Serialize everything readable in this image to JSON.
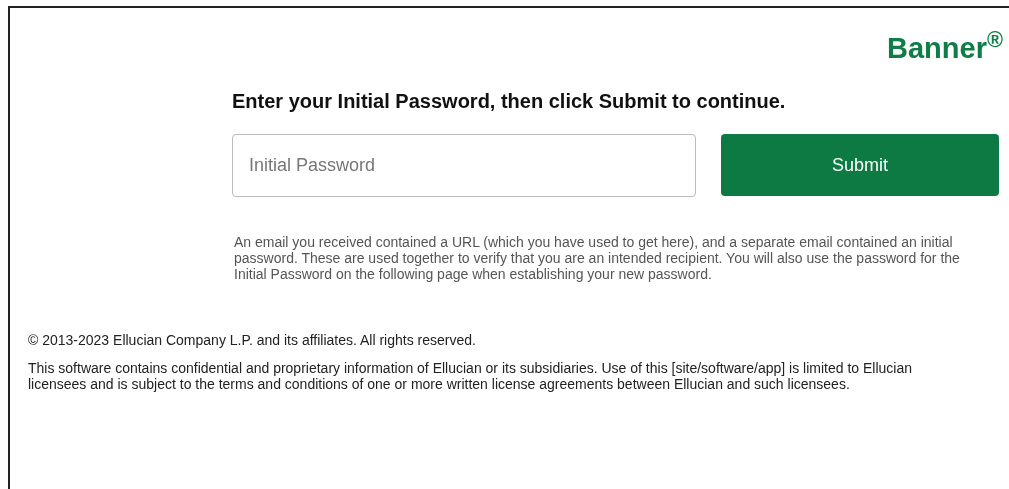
{
  "logo": "Banner$^{®}$",
  "heading": "Enter your Initial Password, then click Submit to continue.",
  "password_field": {
    "placeholder": "Initial Password"
  },
  "submit_button": "Submit",
  "help_text": "An email you received contained a URL (which you have used to get here), and a separate email contained an initial password. These are used together to verify that you are an intended recipient. You will also use the password for the Initial Password on the following page when establishing your new password.",
  "footer": {
    "copyright": "© 2013-2023 Ellucian Company L.P. and its affiliates. All rights reserved.",
    "notice": "This software contains confidential and proprietary information of Ellucian or its subsidiaries. Use of this [site/software/app] is limited to Ellucian licensees and is subject to the terms and conditions of one or more written license agreements between Ellucian and such licensees."
  }
}
